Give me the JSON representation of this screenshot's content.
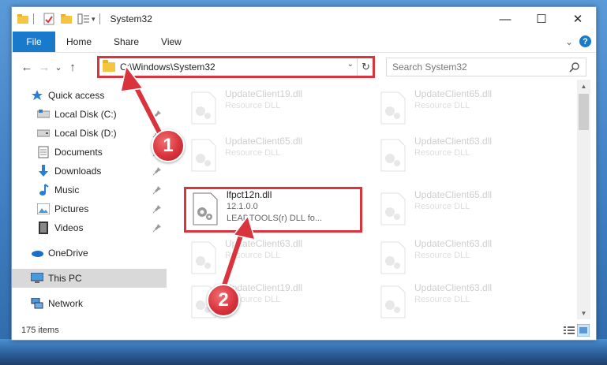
{
  "window": {
    "title": "System32",
    "controls": {
      "minimize": "—",
      "maximize": "☐",
      "close": "✕"
    }
  },
  "ribbon": {
    "tabs": [
      "File",
      "Home",
      "Share",
      "View"
    ],
    "expand": "⌄",
    "help": "?"
  },
  "nav": {
    "back": "←",
    "forward": "→",
    "recent": "⌄",
    "up": "↑",
    "address": "C:\\Windows\\System32",
    "address_dropdown": "⌄",
    "refresh": "↻",
    "search_placeholder": "Search System32"
  },
  "sidebar": {
    "items": [
      {
        "label": "Quick access",
        "icon": "star-icon",
        "pinned": false
      },
      {
        "label": "Local Disk (C:)",
        "icon": "drive-icon",
        "pinned": true
      },
      {
        "label": "Local Disk (D:)",
        "icon": "drive-icon",
        "pinned": true
      },
      {
        "label": "Documents",
        "icon": "documents-icon",
        "pinned": true
      },
      {
        "label": "Downloads",
        "icon": "downloads-icon",
        "pinned": true
      },
      {
        "label": "Music",
        "icon": "music-icon",
        "pinned": true
      },
      {
        "label": "Pictures",
        "icon": "pictures-icon",
        "pinned": true
      },
      {
        "label": "Videos",
        "icon": "videos-icon",
        "pinned": true
      },
      {
        "label": "OneDrive",
        "icon": "onedrive-icon",
        "pinned": false
      },
      {
        "label": "This PC",
        "icon": "this-pc-icon",
        "pinned": false
      },
      {
        "label": "Network",
        "icon": "network-icon",
        "pinned": false
      }
    ]
  },
  "files": [
    {
      "name": "UpdateClient19.dll",
      "desc": "Resource DLL"
    },
    {
      "name": "UpdateClient65.dll",
      "desc": "Resource DLL"
    },
    {
      "name": "UpdateClient65.dll",
      "desc": "Resource DLL"
    },
    {
      "name": "UpdateClient63.dll",
      "desc": "Resource DLL"
    },
    {
      "name": "lfpct12n.dll",
      "desc": "12.1.0.0",
      "desc2": "LEADTOOLS(r) DLL fo..."
    },
    {
      "name": "UpdateClient65.dll",
      "desc": "Resource DLL"
    },
    {
      "name": "UpdateClient63.dll",
      "desc": "Resource DLL"
    },
    {
      "name": "UpdateClient63.dll",
      "desc": "Resource DLL"
    },
    {
      "name": "UpdateClient19.dll",
      "desc": "Resource DLL"
    },
    {
      "name": "UpdateClient63.dll",
      "desc": "Resource DLL"
    }
  ],
  "status": {
    "item_count": "175 items"
  },
  "callouts": [
    "1",
    "2"
  ],
  "colors": {
    "accent": "#1979ca",
    "highlight": "#d9343e",
    "selected": "#d9d9d9"
  }
}
